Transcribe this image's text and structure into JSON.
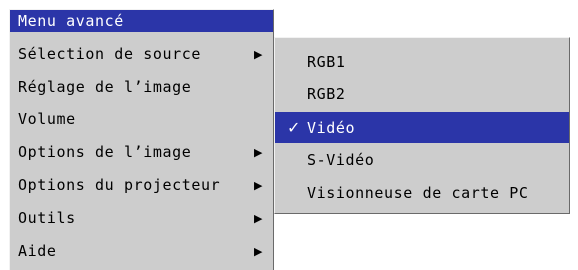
{
  "main_menu": {
    "title": "Menu avancé",
    "items": [
      {
        "label": "Sélection de source",
        "arrow": "▶"
      },
      {
        "label": "Réglage de l’image",
        "arrow": ""
      },
      {
        "label": "Volume",
        "arrow": ""
      },
      {
        "label": "Options de l’image",
        "arrow": "▶"
      },
      {
        "label": "Options du projecteur",
        "arrow": "▶"
      },
      {
        "label": "Outils",
        "arrow": "▶"
      },
      {
        "label": "Aide",
        "arrow": "▶"
      }
    ]
  },
  "submenu": {
    "check_mark": "✓",
    "items": [
      {
        "label": "RGB1"
      },
      {
        "label": "RGB2"
      },
      {
        "label": "Vidéo",
        "selected": true
      },
      {
        "label": "S-Vidéo"
      },
      {
        "label": "Visionneuse de carte PC"
      }
    ]
  },
  "colors": {
    "highlight": "#2b35a8",
    "menu_bg": "#cdcdcd",
    "highlight_text": "#ffffff"
  }
}
